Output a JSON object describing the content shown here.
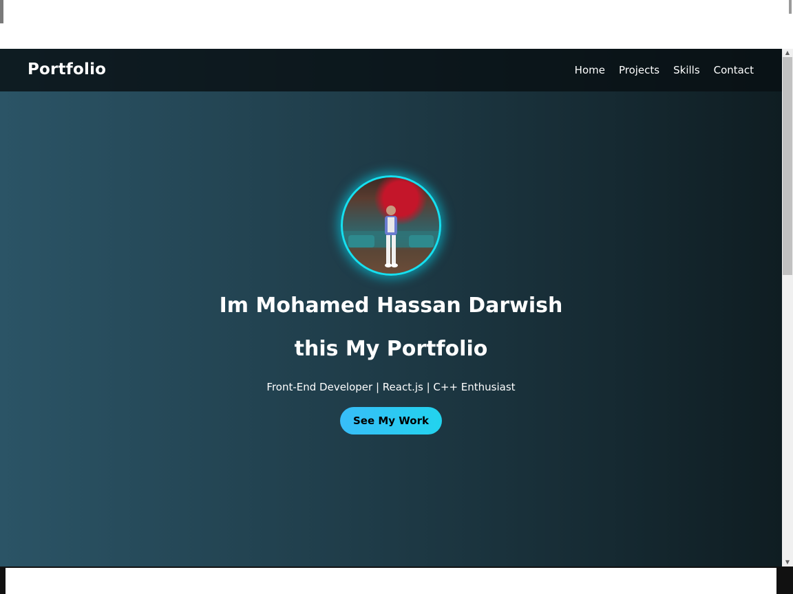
{
  "navbar": {
    "brand": "Portfolio",
    "links": [
      "Home",
      "Projects",
      "Skills",
      "Contact"
    ]
  },
  "hero": {
    "heading_line1": "Im Mohamed Hassan Darwish",
    "heading_line2": "this My Portfolio",
    "tagline": "Front-End Developer | React.js | C++ Enthusiast",
    "button_label": "See My Work"
  },
  "colors": {
    "accent_cyan": "#22d3ee",
    "background_start": "#2b5466",
    "background_end": "#0f1d22"
  }
}
